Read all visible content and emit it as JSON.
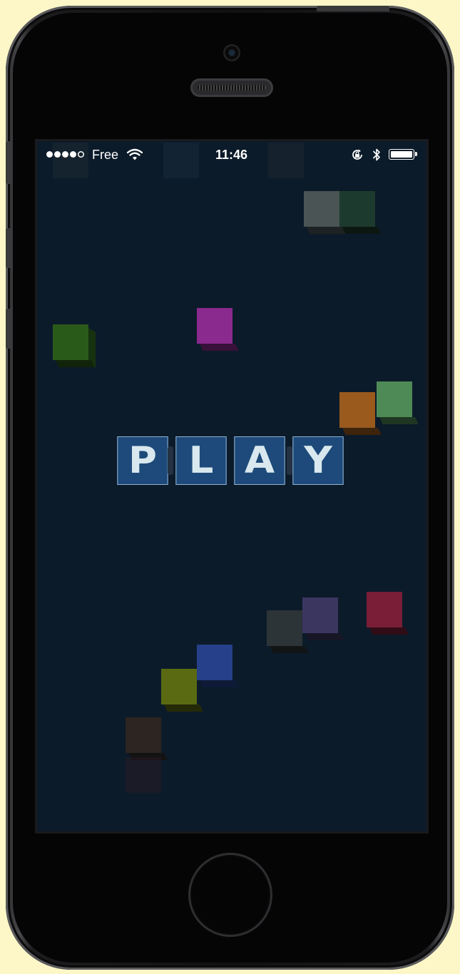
{
  "status_bar": {
    "carrier": "Free",
    "time": "11:46",
    "signal_bars_filled": 4,
    "signal_bars_total": 5,
    "icons": [
      "wifi-icon",
      "rotation-lock-icon",
      "bluetooth-icon",
      "battery-icon"
    ]
  },
  "play_button": {
    "letters": [
      "P",
      "L",
      "A",
      "Y"
    ],
    "tile_color": "#1d4a7a",
    "letter_color": "#d8e8ee"
  },
  "colors": {
    "screen_background": "#0c1b2a",
    "page_background": "#fdf7c8"
  }
}
